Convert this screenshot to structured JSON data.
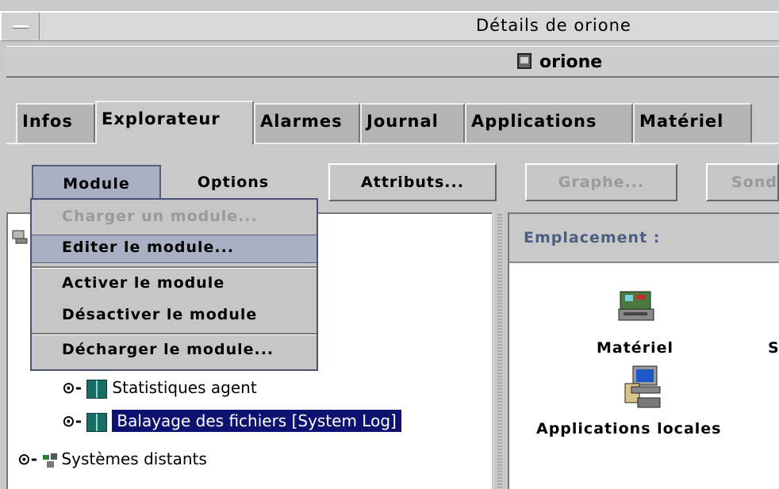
{
  "window": {
    "title": "Détails de orione"
  },
  "host": {
    "name": "orione",
    "icon": "host-icon"
  },
  "tabs": [
    {
      "label": "Infos"
    },
    {
      "label": "Explorateur",
      "active": true
    },
    {
      "label": "Alarmes"
    },
    {
      "label": "Journal"
    },
    {
      "label": "Applications"
    },
    {
      "label": "Matériel"
    }
  ],
  "toolbar": {
    "module": "Module",
    "options": "Options",
    "attributs": "Attributs...",
    "graphe": "Graphe...",
    "sonde": "Sonde"
  },
  "module_menu": {
    "items": [
      {
        "label": "Charger un module...",
        "enabled": false
      },
      {
        "label": "Editer le module...",
        "highlighted": true
      },
      {
        "label": "Activer le module"
      },
      {
        "label": "Désactiver le module"
      },
      {
        "label": "Décharger le module..."
      }
    ]
  },
  "tree": {
    "items": [
      {
        "label": "Statistiques agent",
        "icon": "module-icon"
      },
      {
        "label": "Balayage des fichiers [System Log]",
        "icon": "module-icon",
        "selected": true
      },
      {
        "label": "Systèmes distants",
        "icon": "remote-systems-icon"
      }
    ]
  },
  "right_panel": {
    "location_label": "Emplacement :",
    "icons": [
      {
        "label": "Matériel",
        "icon": "hardware-icon"
      },
      {
        "label": "S",
        "icon": ""
      },
      {
        "label": "Applications locales",
        "icon": "local-applications-icon"
      }
    ]
  },
  "colors": {
    "selection": "#0d1170",
    "menu_highlight": "#a9b0c4",
    "location_label": "#4c5f80"
  }
}
